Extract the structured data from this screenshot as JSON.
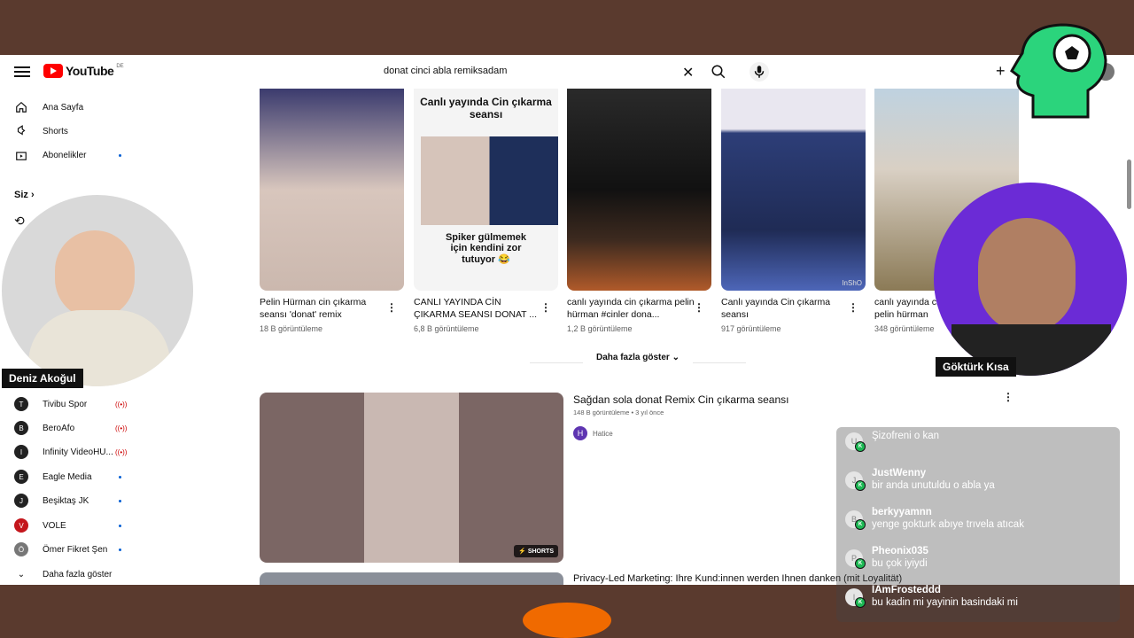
{
  "header": {
    "logo_text": "YouTube",
    "country_code": "DE",
    "search_query": "donat cinci abla remiksadam"
  },
  "sidebar": {
    "main": [
      {
        "label": "Ana Sayfa",
        "icon": "home-icon"
      },
      {
        "label": "Shorts",
        "icon": "shorts-icon"
      },
      {
        "label": "Abonelikler",
        "icon": "subscriptions-icon"
      }
    ],
    "you_label": "Siz",
    "subscriptions": [
      {
        "label": "Tivibu Spor",
        "status": "live"
      },
      {
        "label": "BeroAfo",
        "status": "live"
      },
      {
        "label": "Infinity VideoHU...",
        "status": "live"
      },
      {
        "label": "Eagle Media",
        "status": "new"
      },
      {
        "label": "Beşiktaş JK",
        "status": "new"
      },
      {
        "label": "VOLE",
        "status": "new"
      },
      {
        "label": "Ömer Fikret Şen",
        "status": "new"
      }
    ],
    "show_more": "Daha fazla göster"
  },
  "shorts_row": [
    {
      "title": "Pelin Hürman cin çıkarma seansı 'donat' remix",
      "views": "18 B görüntüleme",
      "overlay_top": "",
      "overlay_bottom": ""
    },
    {
      "title": "CANLI YAYINDA CİN ÇIKARMA SEANSI DONAT ...",
      "views": "6,8 B görüntüleme",
      "overlay_top": "Canlı yayında Cin çıkarma seansı",
      "overlay_bottom": "Spiker gülmemek için kendini zor tutuyor 😂"
    },
    {
      "title": "canlı yayında cin çıkarma pelin hürman #cinler dona...",
      "views": "1,2 B görüntüleme",
      "overlay_top": "",
      "overlay_bottom": ""
    },
    {
      "title": "Canlı yayında Cin çıkarma seansı",
      "views": "917 görüntüleme",
      "overlay_top": "",
      "overlay_bottom": "InShO"
    },
    {
      "title": "canlı yayında cin çıkartma pelin hürman",
      "views": "348 görüntüleme",
      "overlay_top": "",
      "overlay_bottom": ""
    }
  ],
  "show_more_btn": "Daha fazla göster",
  "video_result": {
    "title": "Sağdan sola donat Remix Cin çıkarma seansı",
    "meta": "148 B görüntüleme • 3 yıl önce",
    "channel": "Hatice",
    "channel_initial": "H",
    "badge": "SHORTS"
  },
  "next_video_title": "Privacy-Led Marketing: Ihre Kund:innen werden Ihnen danken (mit Loyalität)",
  "streamers": {
    "left_name": "Deniz Akoğul",
    "right_name": "Göktürk Kısa"
  },
  "chat": [
    {
      "user": "",
      "text": "Şizofreni o kan",
      "initial": "U"
    },
    {
      "user": "JustWenny",
      "text": "bir anda unutuldu o abla ya",
      "initial": "J"
    },
    {
      "user": "berkyyamnn",
      "text": "yenge gokturk abıye trıvela atıcak",
      "initial": "B"
    },
    {
      "user": "Pheonix035",
      "text": "bu çok iyiydi",
      "initial": "P"
    },
    {
      "user": "IAmFrosteddd",
      "text": "bu kadin mi yayinin basindaki mi",
      "initial": "I"
    }
  ],
  "colors": {
    "accent": "#ff0000",
    "brain": "#2bd47c",
    "cam_right_bg": "#6b2bd6",
    "frame": "#5a3a2e"
  }
}
